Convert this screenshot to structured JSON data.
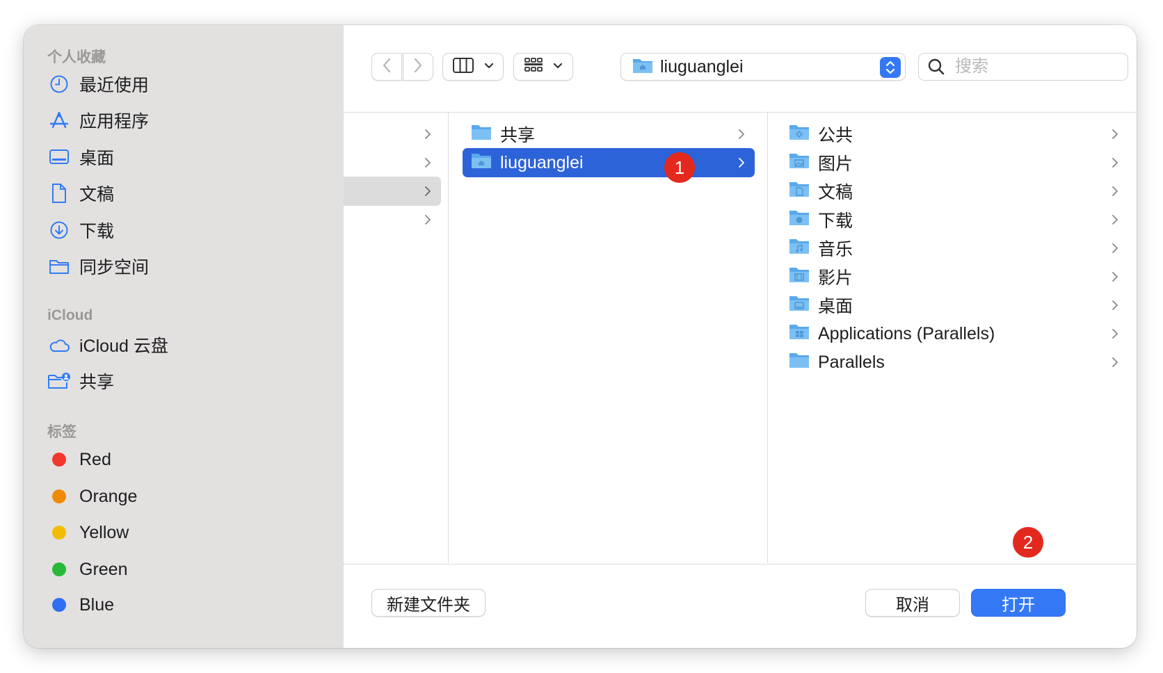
{
  "sidebar": {
    "favorites_title": "个人收藏",
    "favorites": [
      {
        "label": "最近使用",
        "icon": "clock-icon"
      },
      {
        "label": "应用程序",
        "icon": "apps-icon"
      },
      {
        "label": "桌面",
        "icon": "desktop-icon"
      },
      {
        "label": "文稿",
        "icon": "document-icon"
      },
      {
        "label": "下载",
        "icon": "download-icon"
      },
      {
        "label": "同步空间",
        "icon": "folder-icon"
      }
    ],
    "icloud_title": "iCloud",
    "icloud": [
      {
        "label": "iCloud 云盘",
        "icon": "cloud-icon"
      },
      {
        "label": "共享",
        "icon": "shared-folder-icon"
      }
    ],
    "tags_title": "标签",
    "tags": [
      {
        "label": "Red",
        "color": "#f2372d"
      },
      {
        "label": "Orange",
        "color": "#f08a00"
      },
      {
        "label": "Yellow",
        "color": "#f2bd00"
      },
      {
        "label": "Green",
        "color": "#29b93a"
      },
      {
        "label": "Blue",
        "color": "#2f6ff0"
      }
    ]
  },
  "toolbar": {
    "path_label": "liuguanglei",
    "search_placeholder": "搜索"
  },
  "columns": {
    "middle": [
      {
        "label": "共享",
        "selected": false
      },
      {
        "label": "liuguanglei",
        "selected": true
      }
    ],
    "right": [
      {
        "label": "公共",
        "icon": "public-folder-icon"
      },
      {
        "label": "图片",
        "icon": "pictures-folder-icon"
      },
      {
        "label": "文稿",
        "icon": "documents-folder-icon"
      },
      {
        "label": "下载",
        "icon": "downloads-folder-icon"
      },
      {
        "label": "音乐",
        "icon": "music-folder-icon"
      },
      {
        "label": "影片",
        "icon": "movies-folder-icon"
      },
      {
        "label": "桌面",
        "icon": "desktop-folder-icon"
      },
      {
        "label": "Applications (Parallels)",
        "icon": "apps-folder-icon"
      },
      {
        "label": "Parallels",
        "icon": "folder-icon"
      }
    ]
  },
  "badges": {
    "first": "1",
    "second": "2"
  },
  "footer": {
    "new_folder_label": "新建文件夹",
    "cancel_label": "取消",
    "open_label": "打开"
  },
  "colors": {
    "accent": "#3478f6",
    "selection": "#2d63d9",
    "badge": "#e3291e"
  }
}
